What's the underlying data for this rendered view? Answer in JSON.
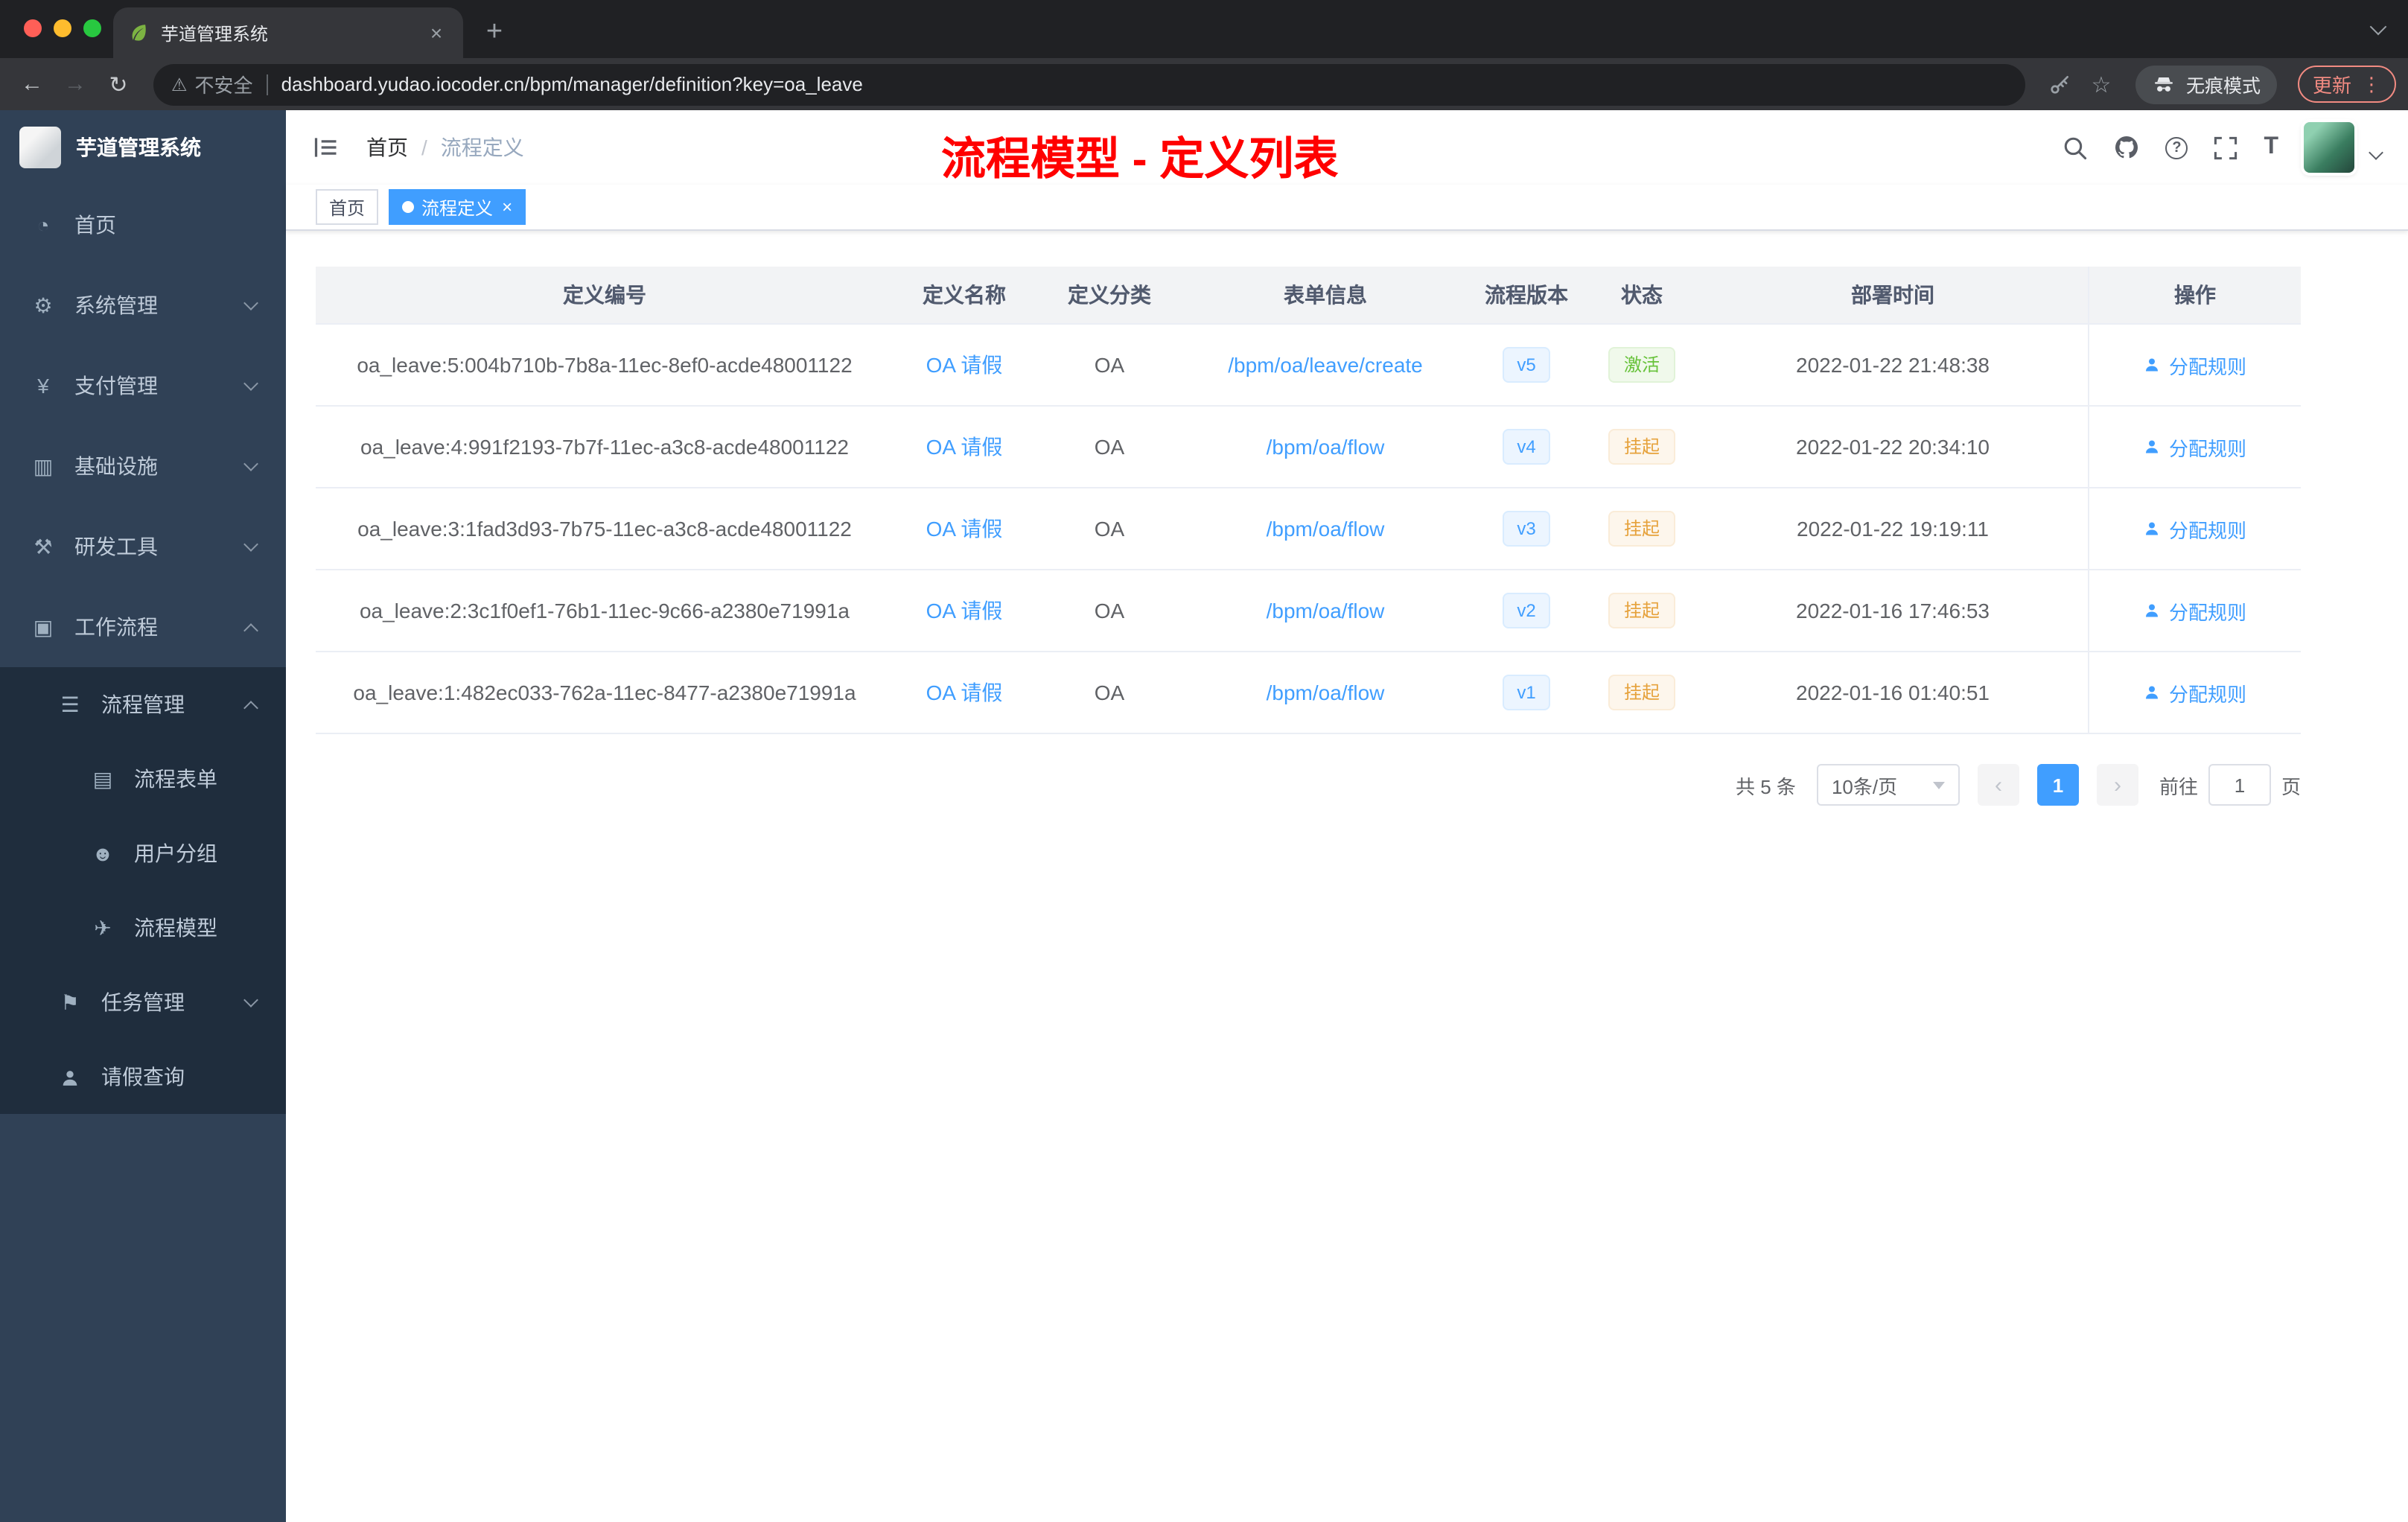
{
  "colors": {
    "accent": "#409eff",
    "title_red": "#ff0000",
    "success": "#67c23a",
    "warning": "#e6a23c",
    "sidebar_bg": "#304156",
    "submenu_bg": "#1f2d3d"
  },
  "browser": {
    "tab_title": "芋道管理系统",
    "security_label": "不安全",
    "url": "dashboard.yudao.iocoder.cn/bpm/manager/definition?key=oa_leave",
    "incognito_label": "无痕模式",
    "update_label": "更新"
  },
  "icons": {
    "close": "×",
    "new_tab": "+",
    "back": "←",
    "forward": "→",
    "reload": "↻",
    "warning": "⚠",
    "star": "☆",
    "menu_dots": "⋮",
    "question": "?",
    "font_size": "T",
    "dashboard": "◔",
    "gear": "⚙",
    "yen": "¥",
    "infra": "▥",
    "tools": "⚒",
    "briefcase": "▣",
    "list": "☰",
    "form": "▤",
    "users": "☻",
    "plane": "✈",
    "tasks": "⚑",
    "prev": "‹",
    "next": "›"
  },
  "sidebar": {
    "logo_title": "芋道管理系统",
    "items": [
      {
        "label": "首页"
      },
      {
        "label": "系统管理"
      },
      {
        "label": "支付管理"
      },
      {
        "label": "基础设施"
      },
      {
        "label": "研发工具"
      },
      {
        "label": "工作流程"
      },
      {
        "label": "流程管理"
      },
      {
        "label": "流程表单"
      },
      {
        "label": "用户分组"
      },
      {
        "label": "流程模型"
      },
      {
        "label": "任务管理"
      },
      {
        "label": "请假查询"
      }
    ]
  },
  "header": {
    "breadcrumb_home": "首页",
    "breadcrumb_sep": "/",
    "breadcrumb_current": "流程定义",
    "overlay_title": "流程模型 - 定义列表"
  },
  "tags": {
    "home": "首页",
    "current": "流程定义"
  },
  "table": {
    "columns": [
      "定义编号",
      "定义名称",
      "定义分类",
      "表单信息",
      "流程版本",
      "状态",
      "部署时间",
      "操作"
    ],
    "rows": [
      {
        "id": "oa_leave:5:004b710b-7b8a-11ec-8ef0-acde48001122",
        "name": "OA 请假",
        "category": "OA",
        "form": "/bpm/oa/leave/create",
        "version": "v5",
        "status": "激活",
        "time": "2022-01-22 21:48:38",
        "action": "分配规则"
      },
      {
        "id": "oa_leave:4:991f2193-7b7f-11ec-a3c8-acde48001122",
        "name": "OA 请假",
        "category": "OA",
        "form": "/bpm/oa/flow",
        "version": "v4",
        "status": "挂起",
        "time": "2022-01-22 20:34:10",
        "action": "分配规则"
      },
      {
        "id": "oa_leave:3:1fad3d93-7b75-11ec-a3c8-acde48001122",
        "name": "OA 请假",
        "category": "OA",
        "form": "/bpm/oa/flow",
        "version": "v3",
        "status": "挂起",
        "time": "2022-01-22 19:19:11",
        "action": "分配规则"
      },
      {
        "id": "oa_leave:2:3c1f0ef1-76b1-11ec-9c66-a2380e71991a",
        "name": "OA 请假",
        "category": "OA",
        "form": "/bpm/oa/flow",
        "version": "v2",
        "status": "挂起",
        "time": "2022-01-16 17:46:53",
        "action": "分配规则"
      },
      {
        "id": "oa_leave:1:482ec033-762a-11ec-8477-a2380e71991a",
        "name": "OA 请假",
        "category": "OA",
        "form": "/bpm/oa/flow",
        "version": "v1",
        "status": "挂起",
        "time": "2022-01-16 01:40:51",
        "action": "分配规则"
      }
    ]
  },
  "pagination": {
    "total": "共 5 条",
    "page_size": "10条/页",
    "current_page": "1",
    "goto_label": "前往",
    "goto_value": "1",
    "unit_label": "页"
  }
}
